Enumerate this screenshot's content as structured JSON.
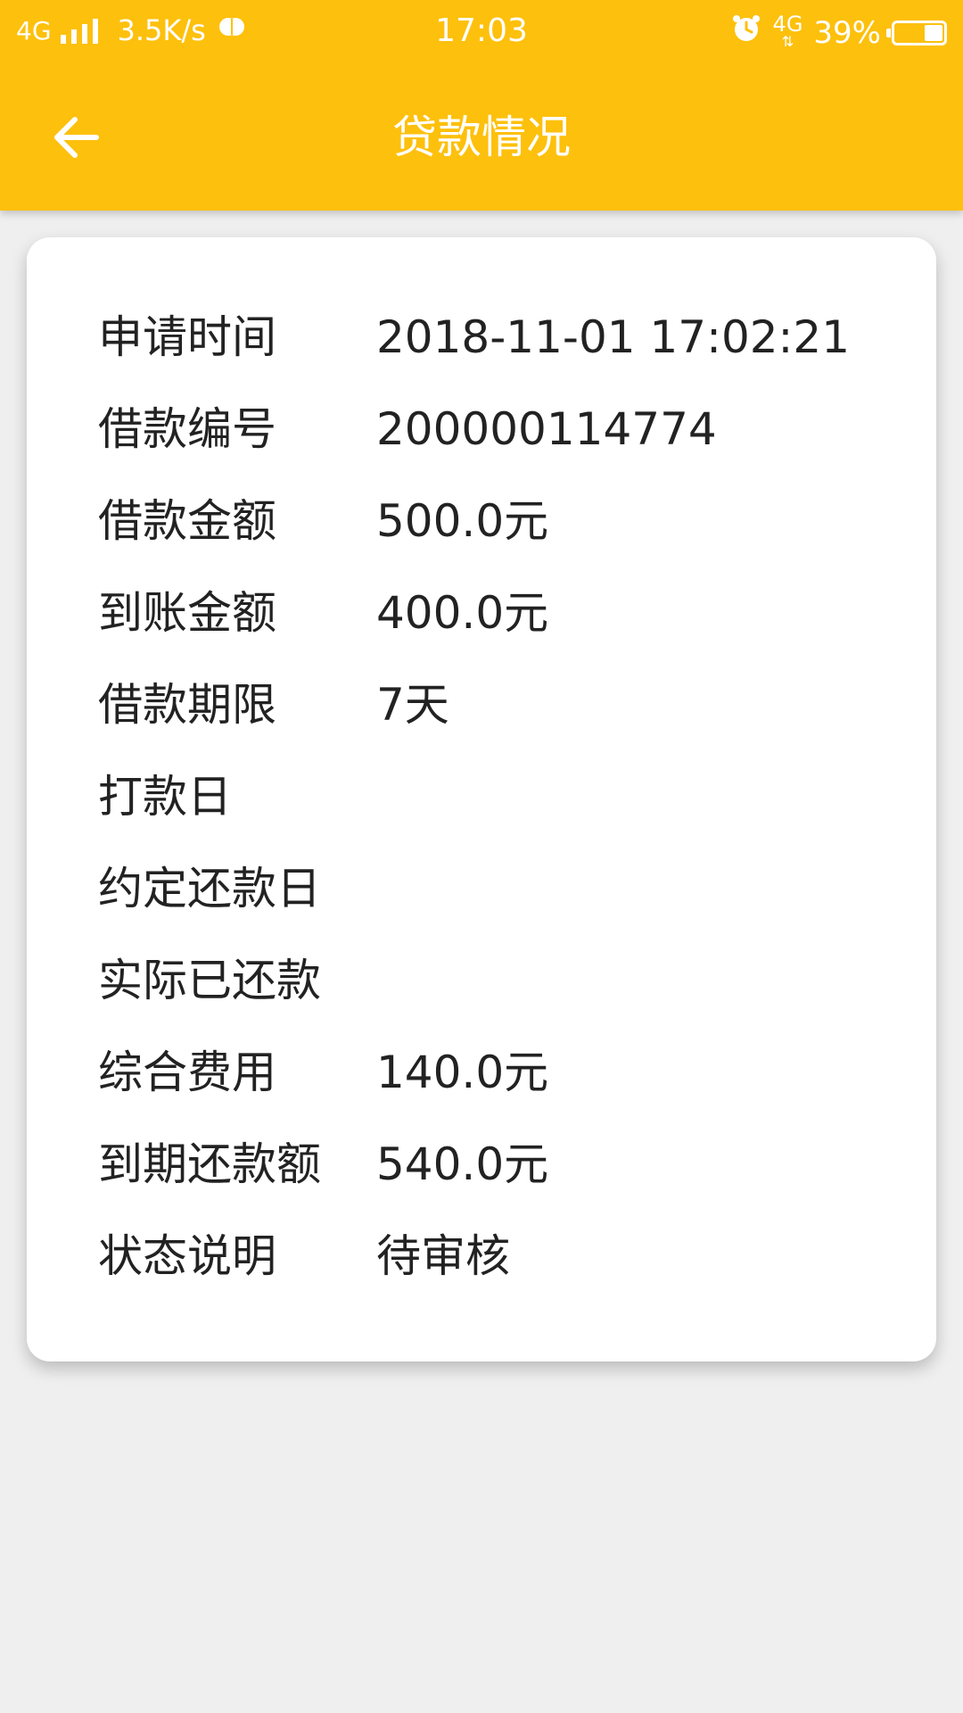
{
  "status_bar": {
    "network_type": "4G",
    "speed": "3.5K/s",
    "time": "17:03",
    "right_network": "4G",
    "battery_percent": "39%",
    "battery_level": 0.39
  },
  "header": {
    "title": "贷款情况",
    "background_color": "#fdc00c"
  },
  "details": [
    {
      "label": "申请时间",
      "value": "2018-11-01 17:02:21"
    },
    {
      "label": "借款编号",
      "value": "200000114774"
    },
    {
      "label": "借款金额",
      "value": "500.0元"
    },
    {
      "label": "到账金额",
      "value": "400.0元"
    },
    {
      "label": "借款期限",
      "value": "7天"
    },
    {
      "label": "打款日",
      "value": ""
    },
    {
      "label": "约定还款日",
      "value": ""
    },
    {
      "label": "实际已还款",
      "value": ""
    },
    {
      "label": "综合费用",
      "value": "140.0元"
    },
    {
      "label": "到期还款额",
      "value": "540.0元"
    },
    {
      "label": "状态说明",
      "value": "待审核"
    }
  ]
}
